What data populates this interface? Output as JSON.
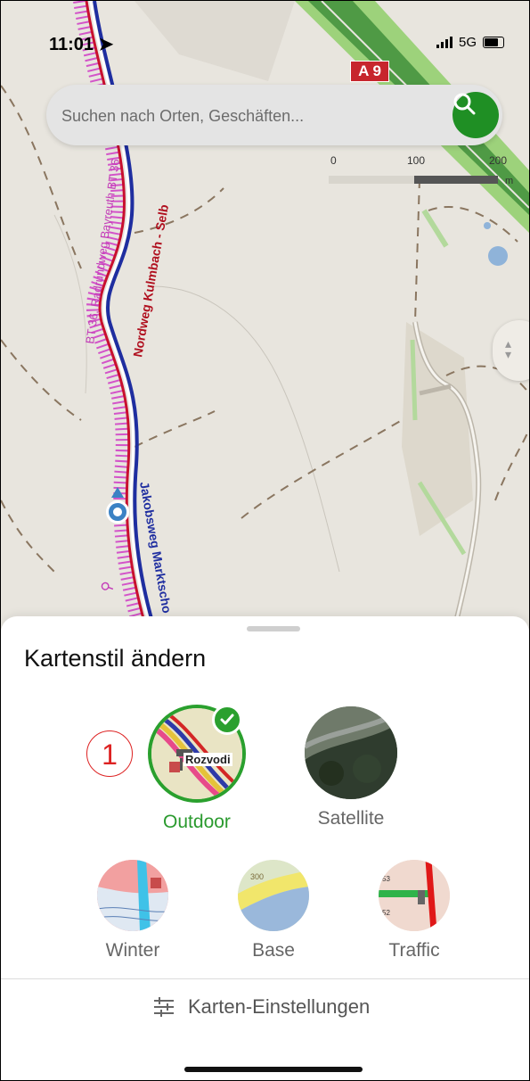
{
  "status_bar": {
    "time": "11:01",
    "network": "5G"
  },
  "map": {
    "road_shield": "A 9",
    "route_labels": [
      "BT 36, Radrundweg Bayreuth BT 36",
      "Nordweg Kulmbach - Selb",
      "Jakobsweg Marktscho"
    ],
    "scale": {
      "labels": [
        "0",
        "100",
        "200"
      ],
      "unit": "m"
    }
  },
  "search": {
    "placeholder": "Suchen nach Orten, Geschäften..."
  },
  "sheet": {
    "title": "Kartenstil ändern",
    "annotation": "1",
    "styles": [
      {
        "label": "Outdoor",
        "selected": true,
        "thumb_text": "Rozvodi"
      },
      {
        "label": "Satellite",
        "selected": false
      },
      {
        "label": "Winter",
        "selected": false
      },
      {
        "label": "Base",
        "selected": false,
        "thumb_text": "300"
      },
      {
        "label": "Traffic",
        "selected": false,
        "thumb_text": [
          "53",
          "52"
        ]
      }
    ],
    "settings_label": "Karten-Einstellungen"
  },
  "colors": {
    "accent": "#2aa02e",
    "search_button": "#1f8f24",
    "shield": "#c7262d"
  }
}
